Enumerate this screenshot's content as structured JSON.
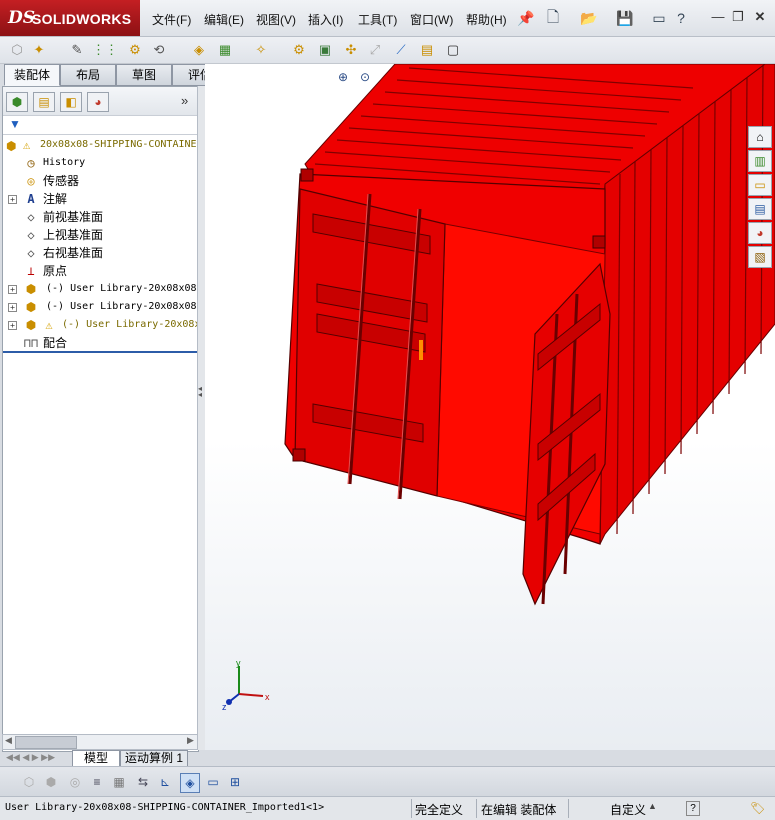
{
  "app": {
    "logo_ds": "DS",
    "logo_name": "SOLIDWORKS"
  },
  "menu": [
    "文件(F)",
    "编辑(E)",
    "视图(V)",
    "插入(I)",
    "工具(T)",
    "窗口(W)",
    "帮助(H)"
  ],
  "tabs": [
    "装配体",
    "布局",
    "草图",
    "评估"
  ],
  "feature_tree": {
    "root": "20x08x08-SHIPPING-CONTAINE",
    "items": [
      {
        "label": "History",
        "icon": "history-icon"
      },
      {
        "label": "传感器",
        "icon": "sensor-icon"
      },
      {
        "label": "注解",
        "icon": "annotation-icon"
      },
      {
        "label": "前视基准面",
        "icon": "plane-icon"
      },
      {
        "label": "上视基准面",
        "icon": "plane-icon"
      },
      {
        "label": "右视基准面",
        "icon": "plane-icon"
      },
      {
        "label": "原点",
        "icon": "origin-icon"
      },
      {
        "label": "(-) User Library-20x08x08-",
        "icon": "part-icon"
      },
      {
        "label": "(-) User Library-20x08x08-",
        "icon": "part-icon"
      },
      {
        "label": "(-) User Library-20x08x",
        "icon": "part-warning-icon"
      },
      {
        "label": "配合",
        "icon": "mates-icon"
      }
    ]
  },
  "bottom_tabs": [
    "模型",
    "运动算例 1"
  ],
  "status": {
    "left": "User Library-20x08x08-SHIPPING-CONTAINER_Imported1<1>",
    "fully_defined": "完全定义",
    "editing": "在编辑 装配体",
    "custom": "自定义",
    "help": "?"
  },
  "axes": {
    "x": "x",
    "y": "y",
    "z": "z"
  },
  "colors": {
    "container": "#ff0000",
    "container_dark": "#b80000",
    "door_inner": "#e60000"
  }
}
